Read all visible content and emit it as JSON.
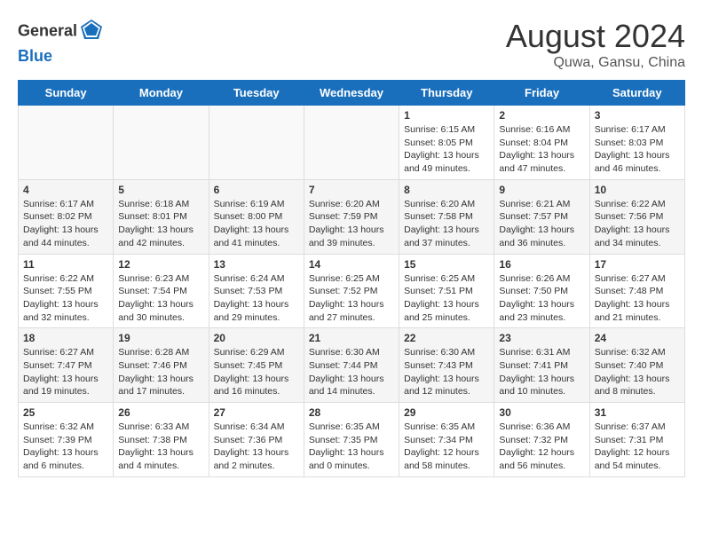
{
  "header": {
    "logo_general": "General",
    "logo_blue": "Blue",
    "month_year": "August 2024",
    "location": "Quwa, Gansu, China"
  },
  "days_of_week": [
    "Sunday",
    "Monday",
    "Tuesday",
    "Wednesday",
    "Thursday",
    "Friday",
    "Saturday"
  ],
  "weeks": [
    {
      "shaded": false,
      "days": [
        {
          "num": "",
          "info": ""
        },
        {
          "num": "",
          "info": ""
        },
        {
          "num": "",
          "info": ""
        },
        {
          "num": "",
          "info": ""
        },
        {
          "num": "1",
          "info": "Sunrise: 6:15 AM\nSunset: 8:05 PM\nDaylight: 13 hours\nand 49 minutes."
        },
        {
          "num": "2",
          "info": "Sunrise: 6:16 AM\nSunset: 8:04 PM\nDaylight: 13 hours\nand 47 minutes."
        },
        {
          "num": "3",
          "info": "Sunrise: 6:17 AM\nSunset: 8:03 PM\nDaylight: 13 hours\nand 46 minutes."
        }
      ]
    },
    {
      "shaded": true,
      "days": [
        {
          "num": "4",
          "info": "Sunrise: 6:17 AM\nSunset: 8:02 PM\nDaylight: 13 hours\nand 44 minutes."
        },
        {
          "num": "5",
          "info": "Sunrise: 6:18 AM\nSunset: 8:01 PM\nDaylight: 13 hours\nand 42 minutes."
        },
        {
          "num": "6",
          "info": "Sunrise: 6:19 AM\nSunset: 8:00 PM\nDaylight: 13 hours\nand 41 minutes."
        },
        {
          "num": "7",
          "info": "Sunrise: 6:20 AM\nSunset: 7:59 PM\nDaylight: 13 hours\nand 39 minutes."
        },
        {
          "num": "8",
          "info": "Sunrise: 6:20 AM\nSunset: 7:58 PM\nDaylight: 13 hours\nand 37 minutes."
        },
        {
          "num": "9",
          "info": "Sunrise: 6:21 AM\nSunset: 7:57 PM\nDaylight: 13 hours\nand 36 minutes."
        },
        {
          "num": "10",
          "info": "Sunrise: 6:22 AM\nSunset: 7:56 PM\nDaylight: 13 hours\nand 34 minutes."
        }
      ]
    },
    {
      "shaded": false,
      "days": [
        {
          "num": "11",
          "info": "Sunrise: 6:22 AM\nSunset: 7:55 PM\nDaylight: 13 hours\nand 32 minutes."
        },
        {
          "num": "12",
          "info": "Sunrise: 6:23 AM\nSunset: 7:54 PM\nDaylight: 13 hours\nand 30 minutes."
        },
        {
          "num": "13",
          "info": "Sunrise: 6:24 AM\nSunset: 7:53 PM\nDaylight: 13 hours\nand 29 minutes."
        },
        {
          "num": "14",
          "info": "Sunrise: 6:25 AM\nSunset: 7:52 PM\nDaylight: 13 hours\nand 27 minutes."
        },
        {
          "num": "15",
          "info": "Sunrise: 6:25 AM\nSunset: 7:51 PM\nDaylight: 13 hours\nand 25 minutes."
        },
        {
          "num": "16",
          "info": "Sunrise: 6:26 AM\nSunset: 7:50 PM\nDaylight: 13 hours\nand 23 minutes."
        },
        {
          "num": "17",
          "info": "Sunrise: 6:27 AM\nSunset: 7:48 PM\nDaylight: 13 hours\nand 21 minutes."
        }
      ]
    },
    {
      "shaded": true,
      "days": [
        {
          "num": "18",
          "info": "Sunrise: 6:27 AM\nSunset: 7:47 PM\nDaylight: 13 hours\nand 19 minutes."
        },
        {
          "num": "19",
          "info": "Sunrise: 6:28 AM\nSunset: 7:46 PM\nDaylight: 13 hours\nand 17 minutes."
        },
        {
          "num": "20",
          "info": "Sunrise: 6:29 AM\nSunset: 7:45 PM\nDaylight: 13 hours\nand 16 minutes."
        },
        {
          "num": "21",
          "info": "Sunrise: 6:30 AM\nSunset: 7:44 PM\nDaylight: 13 hours\nand 14 minutes."
        },
        {
          "num": "22",
          "info": "Sunrise: 6:30 AM\nSunset: 7:43 PM\nDaylight: 13 hours\nand 12 minutes."
        },
        {
          "num": "23",
          "info": "Sunrise: 6:31 AM\nSunset: 7:41 PM\nDaylight: 13 hours\nand 10 minutes."
        },
        {
          "num": "24",
          "info": "Sunrise: 6:32 AM\nSunset: 7:40 PM\nDaylight: 13 hours\nand 8 minutes."
        }
      ]
    },
    {
      "shaded": false,
      "days": [
        {
          "num": "25",
          "info": "Sunrise: 6:32 AM\nSunset: 7:39 PM\nDaylight: 13 hours\nand 6 minutes."
        },
        {
          "num": "26",
          "info": "Sunrise: 6:33 AM\nSunset: 7:38 PM\nDaylight: 13 hours\nand 4 minutes."
        },
        {
          "num": "27",
          "info": "Sunrise: 6:34 AM\nSunset: 7:36 PM\nDaylight: 13 hours\nand 2 minutes."
        },
        {
          "num": "28",
          "info": "Sunrise: 6:35 AM\nSunset: 7:35 PM\nDaylight: 13 hours\nand 0 minutes."
        },
        {
          "num": "29",
          "info": "Sunrise: 6:35 AM\nSunset: 7:34 PM\nDaylight: 12 hours\nand 58 minutes."
        },
        {
          "num": "30",
          "info": "Sunrise: 6:36 AM\nSunset: 7:32 PM\nDaylight: 12 hours\nand 56 minutes."
        },
        {
          "num": "31",
          "info": "Sunrise: 6:37 AM\nSunset: 7:31 PM\nDaylight: 12 hours\nand 54 minutes."
        }
      ]
    }
  ]
}
